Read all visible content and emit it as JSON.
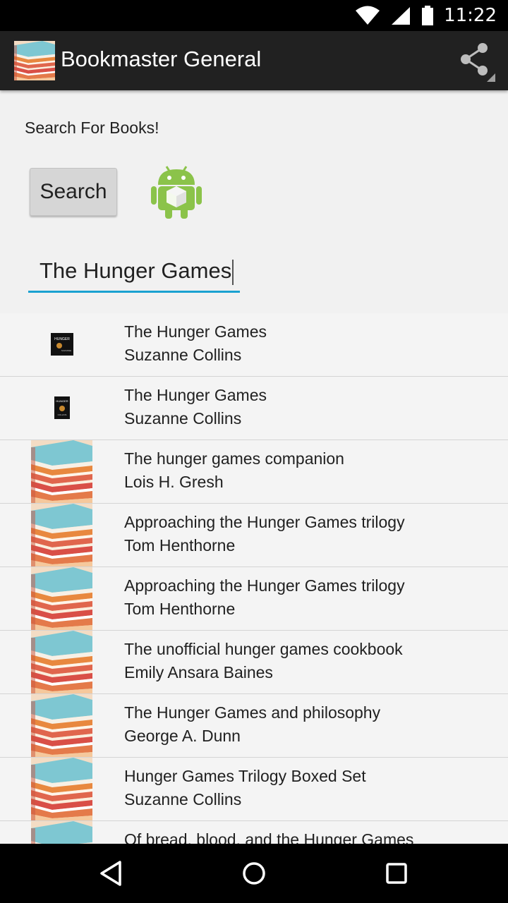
{
  "status_bar": {
    "time": "11:22",
    "icons": [
      "wifi-icon",
      "signal-icon",
      "battery-icon"
    ]
  },
  "app_bar": {
    "title": "Bookmaster General",
    "logo_icon": "books-stack-icon",
    "share_icon": "share-icon"
  },
  "search": {
    "heading": "Search For Books!",
    "button_label": "Search",
    "input_value": "The Hunger Games",
    "accent_color": "#1aa1d1"
  },
  "results": [
    {
      "title": "The Hunger Games",
      "author": "Suzanne Collins",
      "thumb": "hunger-games-cover-wide"
    },
    {
      "title": "The Hunger Games",
      "author": "Suzanne Collins",
      "thumb": "hunger-games-cover-tall"
    },
    {
      "title": "The hunger games companion",
      "author": "Lois H. Gresh",
      "thumb": "placeholder-books"
    },
    {
      "title": "Approaching the Hunger Games trilogy",
      "author": "Tom Henthorne",
      "thumb": "placeholder-books"
    },
    {
      "title": "Approaching the Hunger Games trilogy",
      "author": "Tom Henthorne",
      "thumb": "placeholder-books"
    },
    {
      "title": "The unofficial hunger games cookbook",
      "author": "Emily Ansara Baines",
      "thumb": "placeholder-books"
    },
    {
      "title": "The Hunger Games and philosophy",
      "author": "George A. Dunn",
      "thumb": "placeholder-books"
    },
    {
      "title": "Hunger Games Trilogy Boxed Set",
      "author": "Suzanne Collins",
      "thumb": "placeholder-books"
    },
    {
      "title": "Of bread, blood, and the Hunger Games",
      "author": "",
      "thumb": "placeholder-books"
    }
  ],
  "nav_bar": {
    "buttons": [
      "back-icon",
      "home-icon",
      "recents-icon"
    ]
  }
}
